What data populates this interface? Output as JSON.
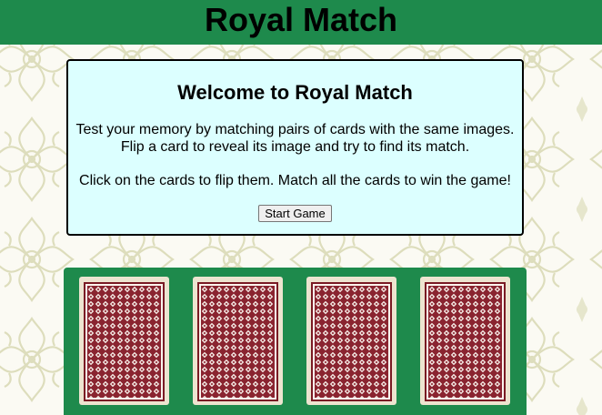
{
  "header": {
    "title": "Royal Match"
  },
  "welcome": {
    "heading": "Welcome to Royal Match",
    "line1": "Test your memory by matching pairs of cards with the same images.",
    "line2": "Flip a card to reveal its image and try to find its match.",
    "instructions": "Click on the cards to flip them. Match all the cards to win the game!",
    "start_label": "Start Game"
  },
  "board": {
    "cards": [
      {
        "state": "face-down"
      },
      {
        "state": "face-down"
      },
      {
        "state": "face-down"
      },
      {
        "state": "face-down"
      }
    ]
  },
  "colors": {
    "header": "#1e8a4c",
    "welcome_panel": "#dcffff",
    "board": "#1e8a4c",
    "card_back": "#7a1a24",
    "card_frame": "#ede4d0"
  }
}
